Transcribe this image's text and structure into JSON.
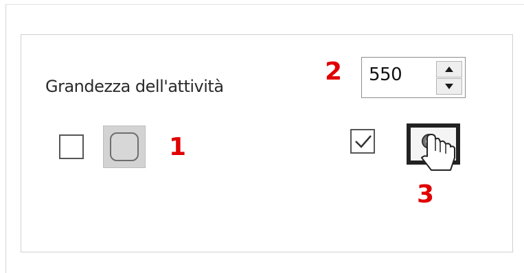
{
  "panel": {
    "size_label": "Grandezza dell'attività",
    "size_value": "550"
  },
  "annotations": {
    "marker_1": "1",
    "marker_2": "2",
    "marker_3": "3"
  },
  "states": {
    "left_checkbox_checked": false,
    "right_checkbox_checked": true,
    "rounded_shape_toggle_active": true,
    "touch_mode_toggle_active": true
  },
  "icons": {
    "spin_up": "triangle-up-icon",
    "spin_down": "triangle-down-icon",
    "rounded": "rounded-square-icon",
    "check": "checkmark-icon",
    "touch": "hand-pointer-icon"
  },
  "colors": {
    "annotation": "#e10000",
    "toggle_active_bg": "#d3d3d3",
    "active_border": "#222222"
  }
}
